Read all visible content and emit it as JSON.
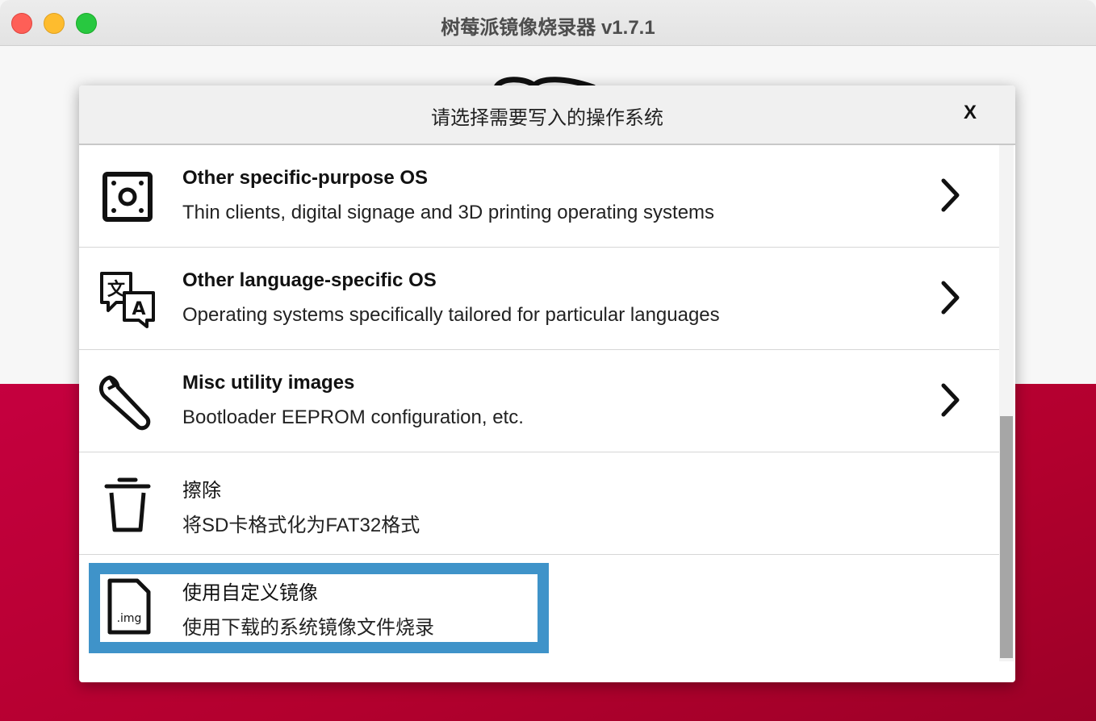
{
  "window": {
    "title": "树莓派镜像烧录器 v1.7.1"
  },
  "dialog": {
    "title": "请选择需要写入的操作系统",
    "close_label": "X"
  },
  "items": [
    {
      "title": "Other specific-purpose OS",
      "description": "Thin clients, digital signage and 3D printing operating systems",
      "icon": "device-icon",
      "has_submenu": true
    },
    {
      "title": "Other language-specific OS",
      "description": "Operating systems specifically tailored for particular languages",
      "icon": "translate-icon",
      "has_submenu": true
    },
    {
      "title": "Misc utility images",
      "description": "Bootloader EEPROM configuration, etc.",
      "icon": "wrench-icon",
      "has_submenu": true
    },
    {
      "title": "擦除",
      "description": "将SD卡格式化为FAT32格式",
      "icon": "trash-icon",
      "has_submenu": false
    },
    {
      "title": "使用自定义镜像",
      "description": "使用下载的系统镜像文件烧录",
      "icon": "img-file-icon",
      "icon_text": ".img",
      "has_submenu": false,
      "selected": true
    }
  ],
  "colors": {
    "accent_red": "#c5003f",
    "selection_blue": "#3f93c9"
  }
}
